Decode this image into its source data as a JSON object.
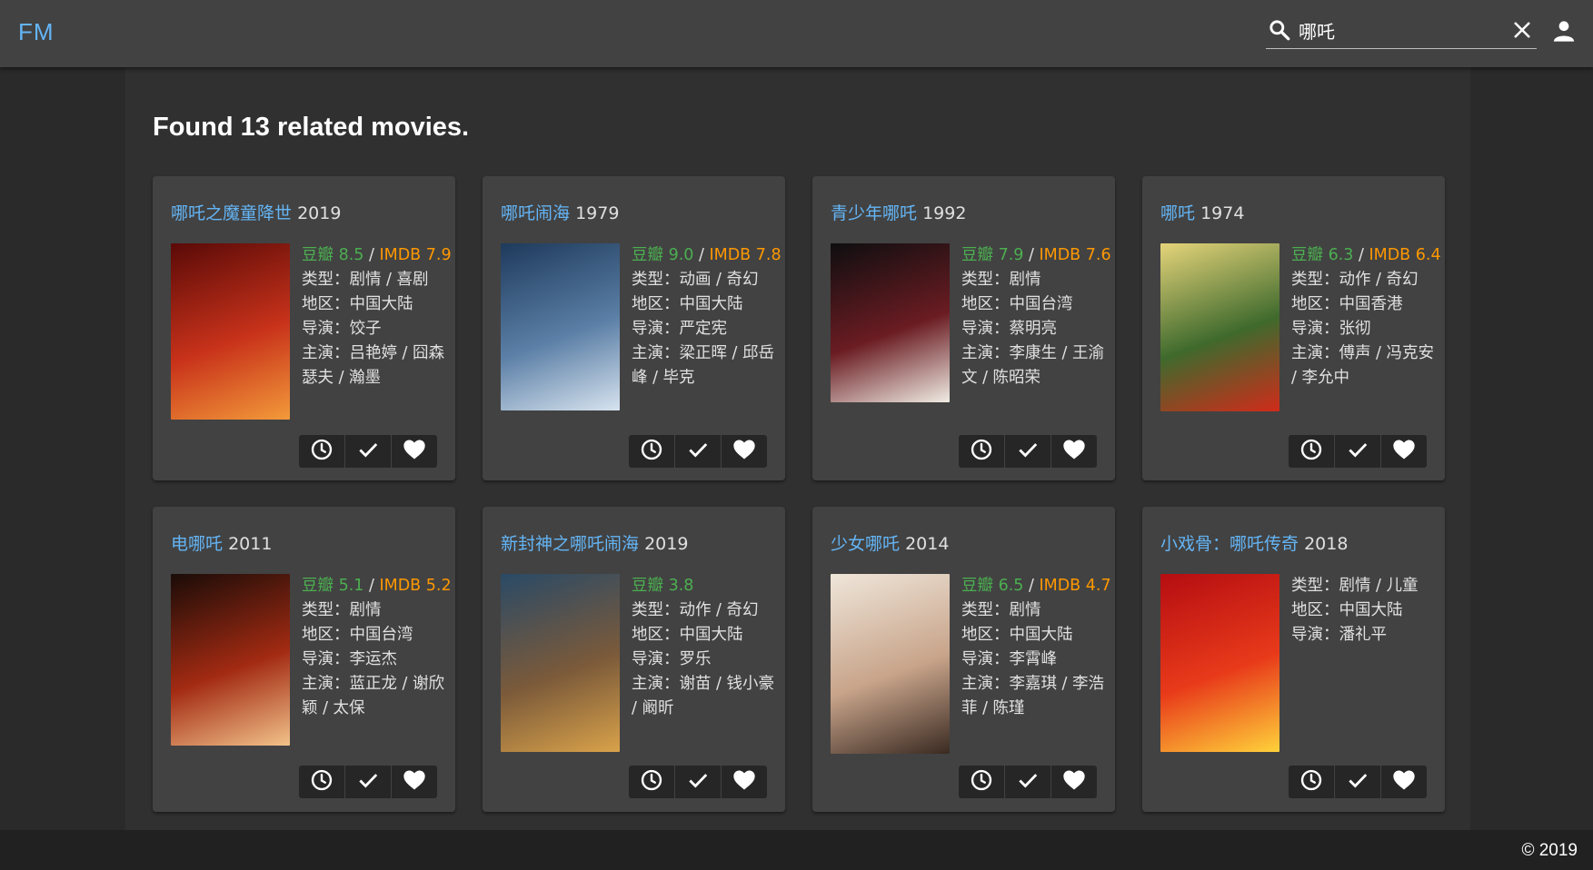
{
  "app": {
    "logo": "FM"
  },
  "search": {
    "value": "哪吒",
    "placeholder": ""
  },
  "results": {
    "heading": "Found 13 related movies."
  },
  "movies": [
    {
      "title": "哪吒之魔童降世",
      "year": "2019",
      "douban_label": "豆瓣 8.5",
      "sep": " / ",
      "imdb_label": "IMDB 7.9",
      "genre": "类型：剧情 / 喜剧",
      "region": "地区：中国大陆",
      "director": "导演：饺子",
      "cast": "主演：吕艳婷 / 囧森瑟夫 / 瀚墨",
      "poster_colors": [
        "#5a0a08",
        "#c8321a",
        "#f39a3a"
      ]
    },
    {
      "title": "哪吒闹海",
      "year": "1979",
      "douban_label": "豆瓣 9.0",
      "sep": " / ",
      "imdb_label": "IMDB 7.8",
      "genre": "类型：动画 / 奇幻",
      "region": "地区：中国大陆",
      "director": "导演：严定宪",
      "cast": "主演：梁正晖 / 邱岳峰 / 毕克",
      "poster_colors": [
        "#1e3a5c",
        "#5b7fa6",
        "#d7e3ef"
      ]
    },
    {
      "title": "青少年哪吒",
      "year": "1992",
      "douban_label": "豆瓣 7.9",
      "sep": " / ",
      "imdb_label": "IMDB 7.6",
      "genre": "类型：剧情",
      "region": "地区：中国台湾",
      "director": "导演：蔡明亮",
      "cast": "主演：李康生 / 王渝文 / 陈昭荣",
      "poster_colors": [
        "#0e0e10",
        "#6a1c22",
        "#f0ece4"
      ]
    },
    {
      "title": "哪吒",
      "year": "1974",
      "douban_label": "豆瓣 6.3",
      "sep": " / ",
      "imdb_label": "IMDB 6.4",
      "genre": "类型：动作 / 奇幻",
      "region": "地区：中国香港",
      "director": "导演：张彻",
      "cast": "主演：傅声 / 冯克安 / 李允中",
      "poster_colors": [
        "#e5d47a",
        "#3f6a2d",
        "#d02b1a"
      ]
    },
    {
      "title": "电哪吒",
      "year": "2011",
      "douban_label": "豆瓣 5.1",
      "sep": " / ",
      "imdb_label": "IMDB 5.2",
      "genre": "类型：剧情",
      "region": "地区：中国台湾",
      "director": "导演：李运杰",
      "cast": "主演：蓝正龙 / 谢欣颖 / 太保",
      "poster_colors": [
        "#1a0c08",
        "#a22a12",
        "#f2c28a"
      ]
    },
    {
      "title": "新封神之哪吒闹海",
      "year": "2019",
      "douban_label": "豆瓣 3.8",
      "sep": "",
      "imdb_label": "",
      "genre": "类型：动作 / 奇幻",
      "region": "地区：中国大陆",
      "director": "导演：罗乐",
      "cast": "主演：谢苗 / 钱小豪 / 阚昕",
      "poster_colors": [
        "#2a4a66",
        "#7b5a3a",
        "#d9a24a"
      ]
    },
    {
      "title": "少女哪吒",
      "year": "2014",
      "douban_label": "豆瓣 6.5",
      "sep": " / ",
      "imdb_label": "IMDB 4.7",
      "genre": "类型：剧情",
      "region": "地区：中国大陆",
      "director": "导演：李霄峰",
      "cast": "主演：李嘉琪 / 李浩菲 / 陈瑾",
      "poster_colors": [
        "#efe6da",
        "#c8a48a",
        "#3a2a22"
      ]
    },
    {
      "title": "小戏骨：哪吒传奇",
      "year": "2018",
      "douban_label": "",
      "sep": "",
      "imdb_label": "",
      "genre": "类型：剧情 / 儿童",
      "region": "地区：中国大陆",
      "director": "导演：潘礼平",
      "cast": "",
      "poster_colors": [
        "#b50d12",
        "#e83a1a",
        "#ffd23a"
      ]
    }
  ],
  "icons": {
    "search": "search-icon",
    "clear": "close-icon",
    "account": "account-icon",
    "watch_later": "clock-icon",
    "watched": "check-icon",
    "favorite": "heart-icon"
  },
  "colors": {
    "accent": "#64b5f6",
    "douban": "#4caf50",
    "imdb": "#ff9800",
    "appbar": "#424242",
    "card": "#424242"
  },
  "footer": {
    "copyright": "© 2019"
  }
}
